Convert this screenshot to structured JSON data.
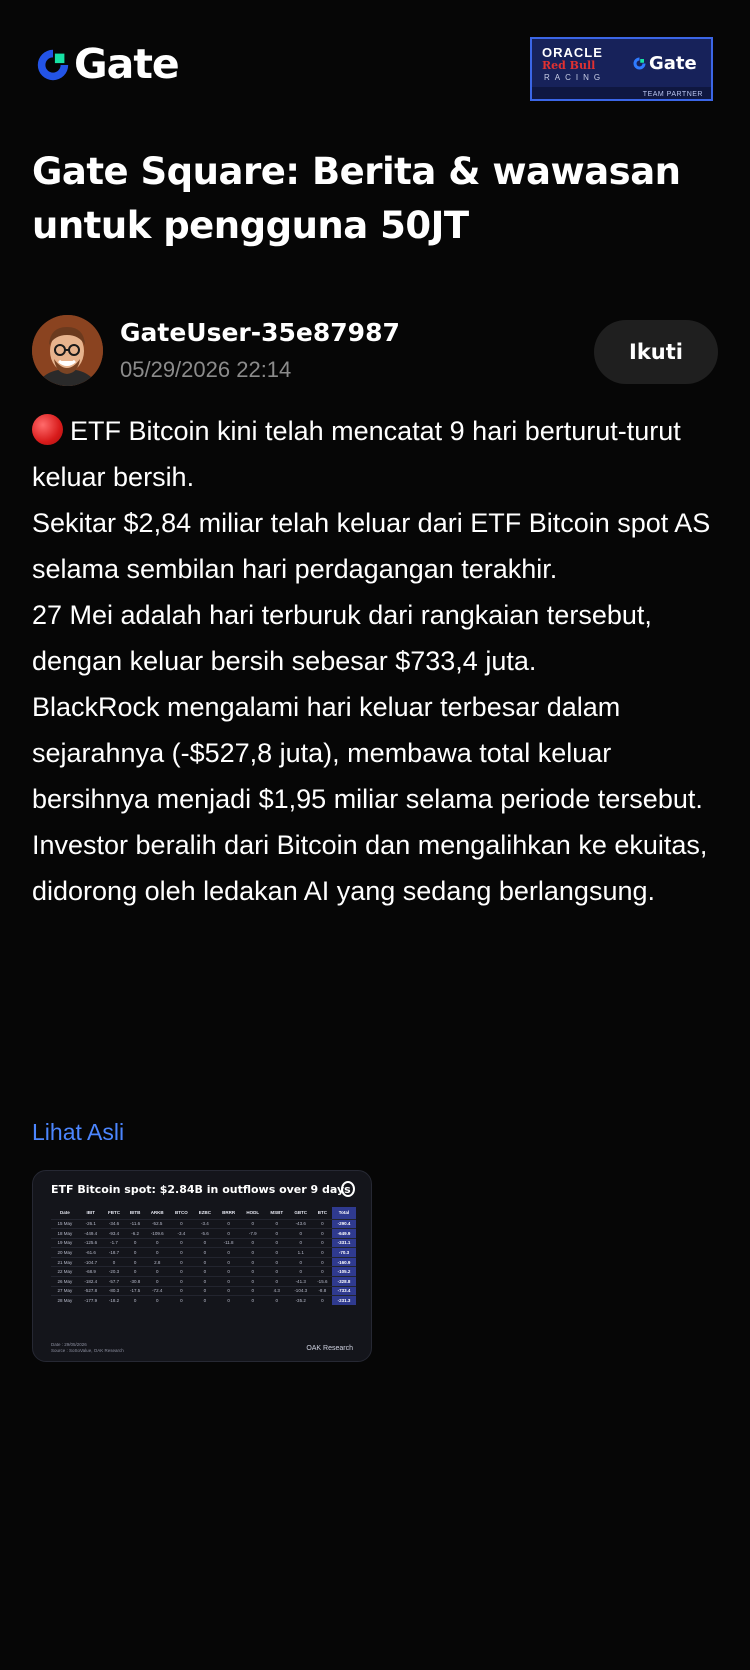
{
  "header": {
    "logo_text": "Gate",
    "logo_icon": "gate-logo-icon",
    "partner": {
      "oracle": "ORACLE",
      "redbull": "Red Bull",
      "racing": "RACING",
      "gate": "Gate",
      "team_partner": "TEAM PARTNER"
    }
  },
  "page_title": "Gate Square: Berita & wawasan untuk pengguna 50JT",
  "author": {
    "username": "GateUser-35e87987",
    "timestamp": "05/29/2026 22:14",
    "follow_label": "Ikuti"
  },
  "post": {
    "paragraphs": [
      "ETF Bitcoin kini telah mencatat 9 hari berturut-turut keluar bersih.",
      "Sekitar $2,84 miliar telah keluar dari ETF Bitcoin spot AS selama sembilan hari perdagangan terakhir.",
      "27 Mei adalah hari terburuk dari rangkaian tersebut, dengan keluar bersih sebesar $733,4 juta.",
      "BlackRock mengalami hari keluar terbesar dalam sejarahnya (-$527,8 juta), membawa total keluar bersihnya menjadi $1,95 miliar selama periode tersebut.",
      "Investor beralih dari Bitcoin dan mengalihkan ke ekuitas, didorong oleh ledakan AI yang sedang berlangsung."
    ],
    "view_original": "Lihat Asli"
  },
  "card": {
    "title": "ETF Bitcoin spot: $2.84B in outflows over 9 days",
    "columns": [
      "Date",
      "IBIT",
      "FBTC",
      "BITB",
      "ARKB",
      "BTCO",
      "EZBC",
      "BRRR",
      "HODL",
      "MSBT",
      "GBTC",
      "BTC",
      "Total"
    ],
    "rows": [
      [
        "15 May",
        "-26.1",
        "-34.6",
        "-11.6",
        "-52.5",
        "0",
        "-3.4",
        "0",
        "0",
        "0",
        "-43.6",
        "0",
        "-290.4"
      ],
      [
        "18 May",
        "-449.4",
        "-93.4",
        "-6.2",
        "-109.6",
        "-3.4",
        "-5.6",
        "0",
        "-7.9",
        "0",
        "0",
        "0",
        "-649.9"
      ],
      [
        "19 May",
        "-125.6",
        "-1.7",
        "0",
        "0",
        "0",
        "0",
        "-11.8",
        "0",
        "0",
        "0",
        "0",
        "-331.1"
      ],
      [
        "20 May",
        "-61.6",
        "-18.7",
        "0",
        "0",
        "0",
        "0",
        "0",
        "0",
        "0",
        "1.1",
        "0",
        "-70.3"
      ],
      [
        "21 May",
        "-104.7",
        "0",
        "0",
        "2.8",
        "0",
        "0",
        "0",
        "0",
        "0",
        "0",
        "0",
        "-160.9"
      ],
      [
        "22 May",
        "-68.9",
        "-20.3",
        "0",
        "0",
        "0",
        "0",
        "0",
        "0",
        "0",
        "0",
        "0",
        "-105.2"
      ],
      [
        "26 May",
        "-182.4",
        "-57.7",
        "-30.8",
        "0",
        "0",
        "0",
        "0",
        "0",
        "0",
        "-41.3",
        "-15.6",
        "-328.8"
      ],
      [
        "27 May",
        "-527.8",
        "-80.3",
        "-17.5",
        "-72.4",
        "0",
        "0",
        "0",
        "0",
        "4.3",
        "-104.3",
        "-8.8",
        "-733.4"
      ],
      [
        "28 May",
        "-177.9",
        "-18.2",
        "0",
        "0",
        "0",
        "0",
        "0",
        "0",
        "0",
        "-35.2",
        "0",
        "-231.3"
      ]
    ],
    "footer_date": "Date : 29/05/2026",
    "footer_source": "Source : SoSoValue, OAK Research",
    "brand": "OAK Research"
  }
}
